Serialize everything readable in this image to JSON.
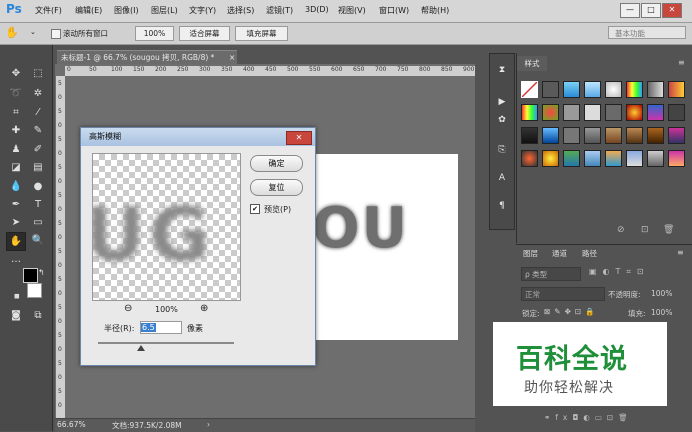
{
  "app": {
    "logo": "Ps"
  },
  "menu": [
    "文件(F)",
    "编辑(E)",
    "图像(I)",
    "图层(L)",
    "文字(Y)",
    "选择(S)",
    "滤镜(T)",
    "3D(D)",
    "视图(V)",
    "窗口(W)",
    "帮助(H)"
  ],
  "window_controls": {
    "min": "—",
    "max": "□",
    "close": "✕"
  },
  "options_bar": {
    "scroll_all_label": "滚动所有窗口",
    "zoom_100": "100%",
    "fit_screen": "适合屏幕",
    "fill_screen": "填充屏幕",
    "workspace": "基本功能"
  },
  "document": {
    "tab_title": "未标题-1 @ 66.7% (sougou 拷贝, RGB/8) *",
    "tab_close": "×",
    "canvas_text": "OU",
    "ruler_h": [
      "0",
      "50",
      "100",
      "150",
      "200",
      "250",
      "300",
      "350",
      "400",
      "450",
      "500",
      "550",
      "600",
      "650",
      "700",
      "750",
      "800",
      "850",
      "900",
      "950"
    ],
    "ruler_v": [
      "5",
      "0",
      "5",
      "0",
      "5",
      "0",
      "5",
      "0",
      "5",
      "0",
      "5",
      "0",
      "5",
      "0",
      "5",
      "0",
      "5",
      "0",
      "5",
      "0",
      "5",
      "0",
      "5",
      "0"
    ]
  },
  "status": {
    "zoom": "66.67%",
    "doc_info": "文档:937.5K/2.08M",
    "arrow": "›"
  },
  "dialog": {
    "title": "高斯模糊",
    "close": "✕",
    "preview_text": "UG",
    "ok": "确定",
    "reset": "复位",
    "preview_label": "预览(P)",
    "zoom_out": "⊖",
    "zoom_value": "100%",
    "zoom_in": "⊕",
    "radius_label": "半径(R):",
    "radius_value": "6.5",
    "radius_unit": "像素"
  },
  "styles_panel": {
    "tab": "样式"
  },
  "layers_panel": {
    "tabs": [
      "图层",
      "通道",
      "路径"
    ],
    "kind_filter": "ρ 类型",
    "blend_mode": "正常",
    "opacity_label": "不透明度:",
    "opacity_value": "100%",
    "lock_label": "锁定:",
    "fill_label": "填充:",
    "fill_value": "100%"
  },
  "watermark": {
    "title": "百科全说",
    "subtitle": "助你轻松解决"
  }
}
